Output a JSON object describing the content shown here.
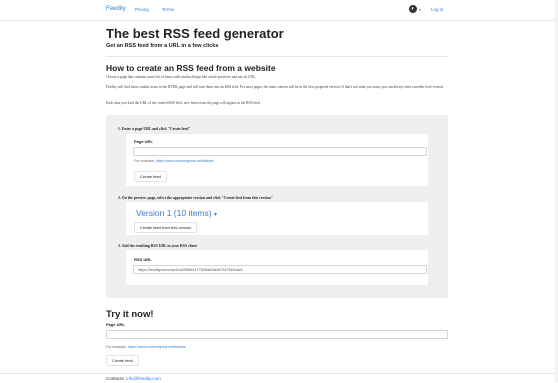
{
  "nav": {
    "brand": "Feedity",
    "links": [
      "Pricing",
      "Terms"
    ],
    "login": "Log in",
    "caret": "▾",
    "globe_icon": "globe-icon"
  },
  "hero": {
    "title": "The best RSS feed generator",
    "subtitle": "Get an RSS feed from a URL in a few clicks"
  },
  "howto": {
    "title": "How to create an RSS feed from a website",
    "paragraphs": [
      "Choose a page that contains some list of items with similar design like article previews and use its URL.",
      "Feedity will find those similar items in the HTML page and will turn them into an RSS feed. For most pages, the main content will be in the first proposed version. If that's not what you want, you can always select another feed version.",
      "Each time you load the URL of the created RSS feed, new items from the page will appear in the RSS feed."
    ]
  },
  "steps": {
    "step1": {
      "label": "1. Enter a page URL and click \"Create feed\"",
      "field_label": "Page URL",
      "input_value": "",
      "hint_prefix": "For example,",
      "hint_link": "https://www.contentgreat.net/kadiste",
      "button": "Create feed"
    },
    "step2": {
      "label": "2. On the preview page, select the appropriate version and click \"Create feed from this version\"",
      "version": "Version 1 (10 items)",
      "caret": "▾",
      "button": "Create feed from this version"
    },
    "step3": {
      "label": "3. Add the resulting RSS URL to your RSS client",
      "field_label": "RSS URL",
      "input_value": "https://feedity.com/rss/11a0058e4177605a83ab87247949cdc6"
    }
  },
  "try": {
    "title": "Try it now!",
    "field_label": "Page URL",
    "input_value": "",
    "hint_prefix": "For example,",
    "hint_link": "https://www.contentgreat.net/kadiste",
    "button": "Create feed"
  },
  "footer": {
    "prefix": "Contacts:",
    "email": "info@feedity.com"
  }
}
